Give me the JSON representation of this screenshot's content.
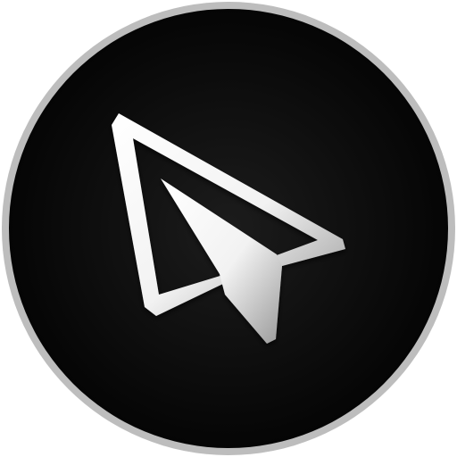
{
  "icon": {
    "name": "paper-plane-icon",
    "colors": {
      "ring": "#bdbdbd",
      "disc_center": "#1c1c1c",
      "disc_edge": "#050505",
      "glyph_light": "#ffffff",
      "glyph_shadow": "#9a9a9a"
    }
  }
}
